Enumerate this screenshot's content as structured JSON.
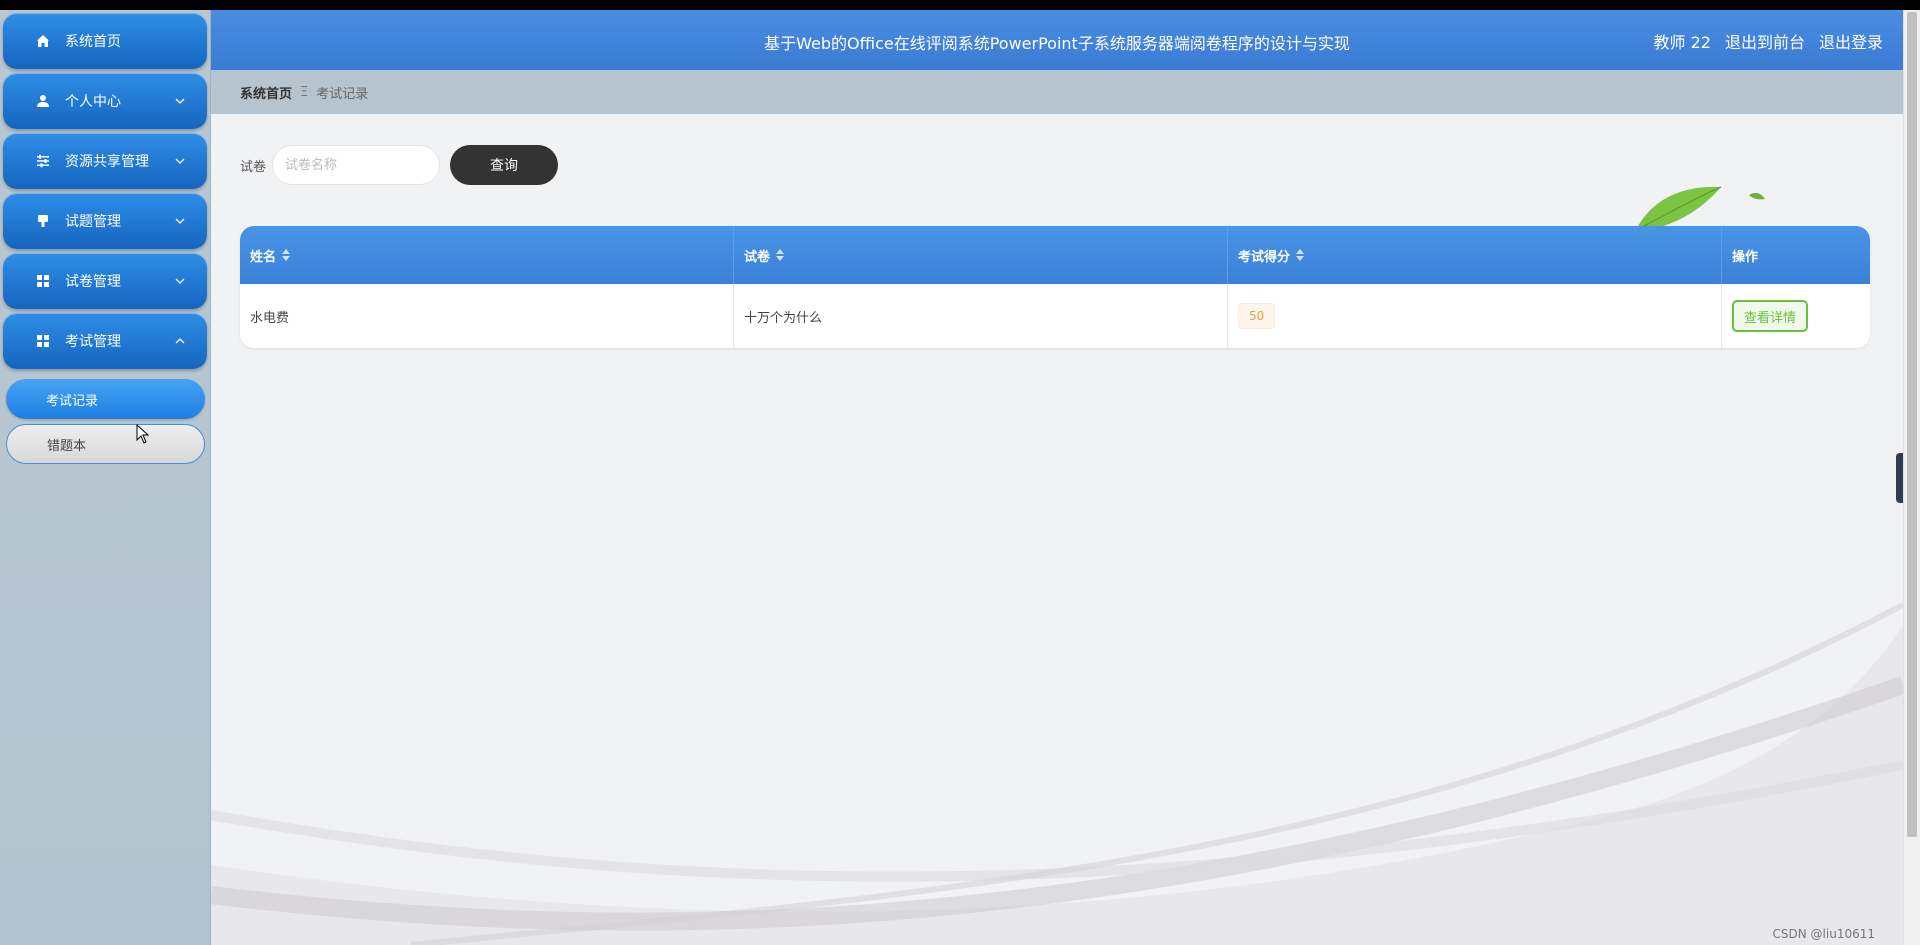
{
  "sidebar": {
    "items": [
      {
        "label": "系统首页",
        "icon": "home-icon"
      },
      {
        "label": "个人中心",
        "icon": "user-icon"
      },
      {
        "label": "资源共享管理",
        "icon": "sliders-icon"
      },
      {
        "label": "试题管理",
        "icon": "pin-icon"
      },
      {
        "label": "试卷管理",
        "icon": "grid-icon"
      },
      {
        "label": "考试管理",
        "icon": "grid-icon"
      }
    ],
    "sub_items": [
      {
        "label": "考试记录",
        "active": true
      },
      {
        "label": "错题本",
        "active": false
      }
    ]
  },
  "header": {
    "title": "基于Web的Office在线评阅系统PowerPoint子系统服务器端阅卷程序的设计与实现",
    "user": "教师 22",
    "frontend_link": "退出到前台",
    "logout_link": "退出登录"
  },
  "breadcrumb": {
    "home": "系统首页",
    "separator": "Ξ",
    "current": "考试记录"
  },
  "search": {
    "label": "试卷",
    "placeholder": "试卷名称",
    "value": "",
    "button": "查询"
  },
  "table": {
    "headers": [
      "姓名",
      "试卷",
      "考试得分",
      "操作"
    ],
    "rows": [
      {
        "name": "水电费",
        "paper": "十万个为什么",
        "score": "50",
        "action": "查看详情"
      }
    ]
  },
  "watermark": "CSDN @liu10611",
  "colors": {
    "accent": "#3a7bd5",
    "sidebar_item": "#1e78d6",
    "score": "#e6a23c",
    "detail": "#67c23a"
  }
}
